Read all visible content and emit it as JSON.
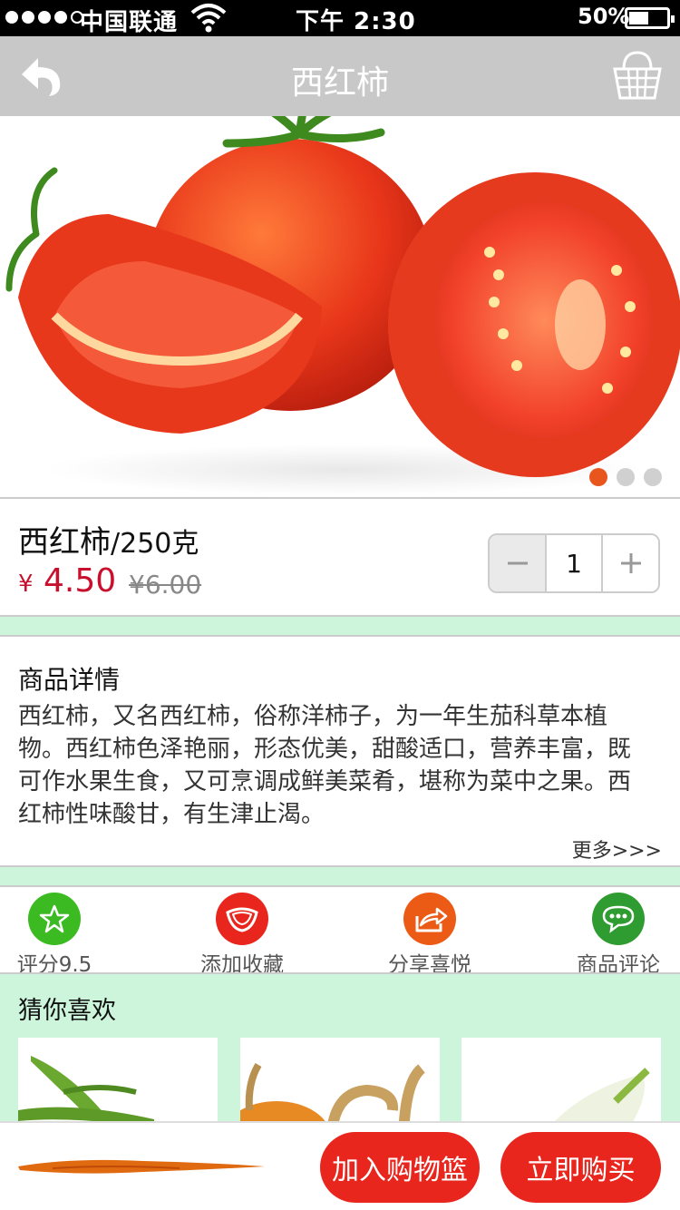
{
  "status_bar": {
    "carrier": "中国联通",
    "time": "下午 2:30",
    "battery": "50%",
    "battery_level": 0.5
  },
  "nav": {
    "title": "西红柿",
    "back_icon": "back-arrow-icon",
    "basket_icon": "basket-icon"
  },
  "hero": {
    "slide_count": 3,
    "active_slide": 1
  },
  "product": {
    "name": "西红柿",
    "unit": "/250克",
    "price_symbol": "¥",
    "price": "4.50",
    "old_price": "¥6.00",
    "quantity": "1"
  },
  "details": {
    "heading": "商品详情",
    "text": "西红柿，又名西红柿，俗称洋柿子，为一年生茄科草本植物。西红柿色泽艳丽，形态优美，甜酸适口，营养丰富，既可作水果生食，又可烹调成鲜美菜肴，堪称为菜中之果。西红柿性味酸甘，有生津止渴。",
    "more": "更多>>>"
  },
  "actions": [
    {
      "label": "评分9.5",
      "icon": "star-icon",
      "color": "#3cba21"
    },
    {
      "label": "添加收藏",
      "icon": "favorite-icon",
      "color": "#e8261e"
    },
    {
      "label": "分享喜悦",
      "icon": "share-icon",
      "color": "#ec5b16"
    },
    {
      "label": "商品评论",
      "icon": "comment-icon",
      "color": "#2e9c30"
    }
  ],
  "recommendations": {
    "heading": "猜你喜欢"
  },
  "bottom": {
    "add_to_basket": "加入购物篮",
    "buy_now": "立即购买"
  },
  "colors": {
    "accent_red": "#e8261e",
    "price_red": "#c8102e",
    "band_green": "#cdf5dc",
    "nav_gray": "#c8c8c8",
    "active_dot": "#e8561e"
  }
}
